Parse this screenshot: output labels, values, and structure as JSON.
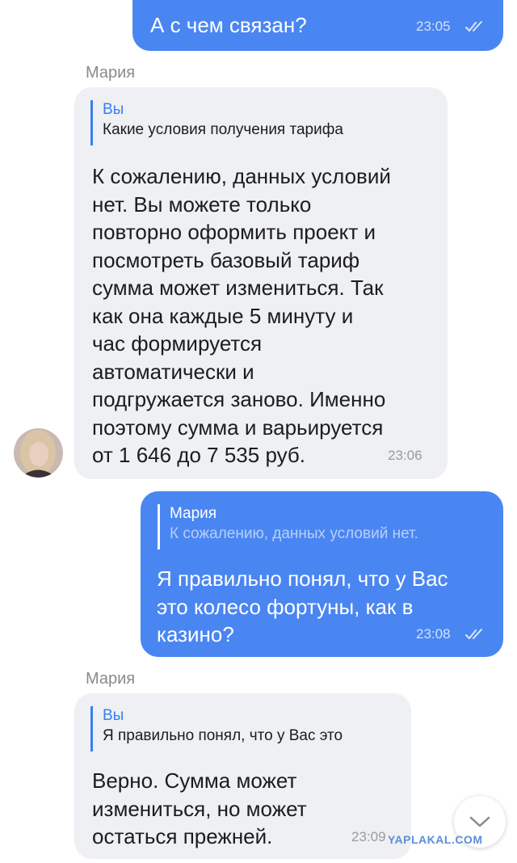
{
  "messages": [
    {
      "text": "А с чем связан?",
      "time": "23:05"
    },
    {
      "sender": "Мария",
      "reply_author": "Вы",
      "reply_text": "Какие условия получения тарифа",
      "text": "К сожалению, данных условий\nнет.  Вы можете только\nповторно оформить проект и\nпосмотреть базовый тариф\nсумма может измениться. Так\nкак она каждые 5 минуту и\nчас формируется\nавтоматически и\nподгружается заново. Именно\nпоэтому сумма и варьируется\nот 1 646 до 7 535 руб.",
      "time": "23:06"
    },
    {
      "reply_author": "Мария",
      "reply_text": "К сожалению, данных условий нет.",
      "text": "Я правильно понял, что у Вас\nэто колесо фортуны, как в\nказино?",
      "time": "23:08"
    },
    {
      "sender": "Мария",
      "reply_author": "Вы",
      "reply_text": "Я правильно понял, что у Вас это",
      "text": "Верно. Сумма может\nизмениться, но может\nостаться прежней.",
      "time": "23:09"
    }
  ],
  "watermark": "YAPLAKAL.COM",
  "icons": {
    "read_ticks": "double-check-icon",
    "scroll_down": "chevron-down-icon",
    "avatar": "avatar"
  },
  "colors": {
    "outgoing_bubble": "#4a86f2",
    "incoming_bubble": "#eef0f3",
    "accent": "#3a7ef0"
  }
}
